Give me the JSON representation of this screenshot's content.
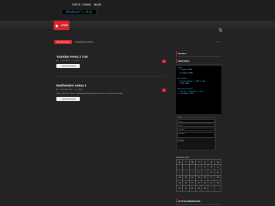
{
  "header": {
    "logo_text": "[RedRoot'r.tld]"
  },
  "nav": {
    "home_icon": "home-icon",
    "items": [
      {
        "label": "HOME",
        "active": true
      },
      {
        "label": "TWITCH",
        "active": false
      },
      {
        "label": "FORUM",
        "active": false
      },
      {
        "label": "IMAGE",
        "active": false
      }
    ],
    "search_icon": "search-icon"
  },
  "ticker": {
    "label": "Breaking News",
    "text": "Youtube Arena 2 Fun",
    "prev": "‹",
    "next": "›"
  },
  "posts": [
    {
      "title": "Youtube Arena 2 Fun",
      "date": "1. April 2022",
      "author": "admin",
      "comments": "1",
      "button": "Continue Reading"
    },
    {
      "title": "Mailhenters Arena 3",
      "date": "22. August 2022",
      "author": "admin",
      "comments": "1",
      "excerpt": "Quartz Mod 1.0.1 / Series : MixTalks (The Site) [Clockwork]: Server IP: 82.223.52.131:8294",
      "button": "Continue Reading"
    }
  ],
  "sidebar": {
    "search_title": "SEARCH",
    "shoutbox_title": "SHOUTBOX",
    "shoutbox_entries": [
      {
        "name": "Sargo",
        "message": "",
        "time": "1 August 2022"
      },
      {
        "name": "",
        "message": "",
        "time": "14 August 2022"
      },
      {
        "name": "hlen-stone",
        "message": "Insalve Bunker & 1000 Grüße",
        "time": "1 May 2022"
      },
      {
        "name": "MrQuisselenlagen",
        "message": "[Servo] + Aesthetic rules",
        "time": "1 December 2022"
      }
    ],
    "shout_form": {
      "header": "Shout",
      "name_placeholder": "Name",
      "email_placeholder": "Email",
      "website_placeholder": "Website",
      "message_placeholder": "Message",
      "button": "Submit"
    },
    "calendar": {
      "caption": "September 2022",
      "weekdays": [
        "M",
        "T",
        "W",
        "T",
        "F",
        "S",
        "S"
      ],
      "weeks": [
        [
          "",
          "",
          "",
          "1",
          "2",
          "3",
          "4"
        ],
        [
          "5",
          "6",
          "7",
          "8",
          "9",
          "10",
          "11"
        ],
        [
          "12",
          "13",
          "14",
          "15",
          "16",
          "17",
          "18"
        ],
        [
          "19",
          "20",
          "21",
          "22",
          "23",
          "24",
          "25"
        ],
        [
          "26",
          "27",
          "28",
          "29",
          "30",
          "",
          ""
        ]
      ]
    },
    "comments_title": "LETZTE KOMMENTARE"
  },
  "colors": {
    "accent": "#d82530",
    "shout_text": "#2fb8e8",
    "background": "#232323"
  }
}
